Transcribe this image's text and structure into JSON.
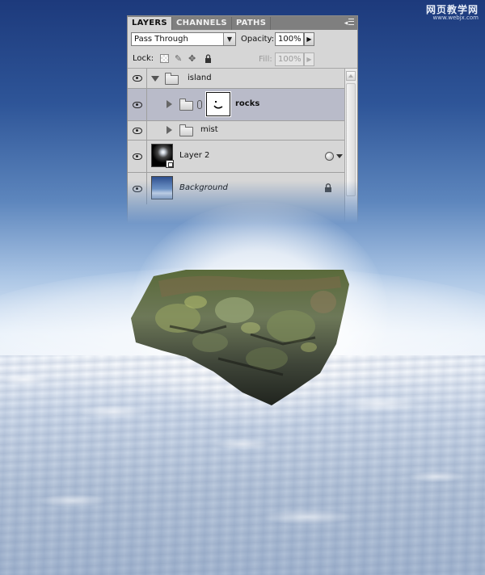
{
  "watermark": {
    "line1": "网页教学网",
    "line2": "www.webjx.com"
  },
  "panel": {
    "tabs": [
      {
        "label": "LAYERS",
        "active": true
      },
      {
        "label": "CHANNELS",
        "active": false
      },
      {
        "label": "PATHS",
        "active": false
      }
    ],
    "menu_icon": "panel-menu-icon",
    "blend_mode": "Pass Through",
    "opacity_label": "Opacity:",
    "opacity_value": "100%",
    "lock_label": "Lock:",
    "fill_label": "Fill:",
    "fill_value": "100%",
    "layers": [
      {
        "name": "island",
        "type": "group",
        "expanded": true,
        "visible": true
      },
      {
        "name": "rocks",
        "type": "group",
        "expanded": false,
        "visible": true,
        "selected": true,
        "has_mask": true
      },
      {
        "name": "mist",
        "type": "group",
        "expanded": false,
        "visible": true
      },
      {
        "name": "Layer 2",
        "type": "smart-object",
        "visible": true,
        "has_effects": true
      },
      {
        "name": "Background",
        "type": "background",
        "visible": true,
        "locked": true
      }
    ]
  },
  "colors": {
    "panel_bg": "#d6d6d6",
    "selected_row": "#b9bbc9",
    "tab_bar": "#7f7f7f"
  }
}
